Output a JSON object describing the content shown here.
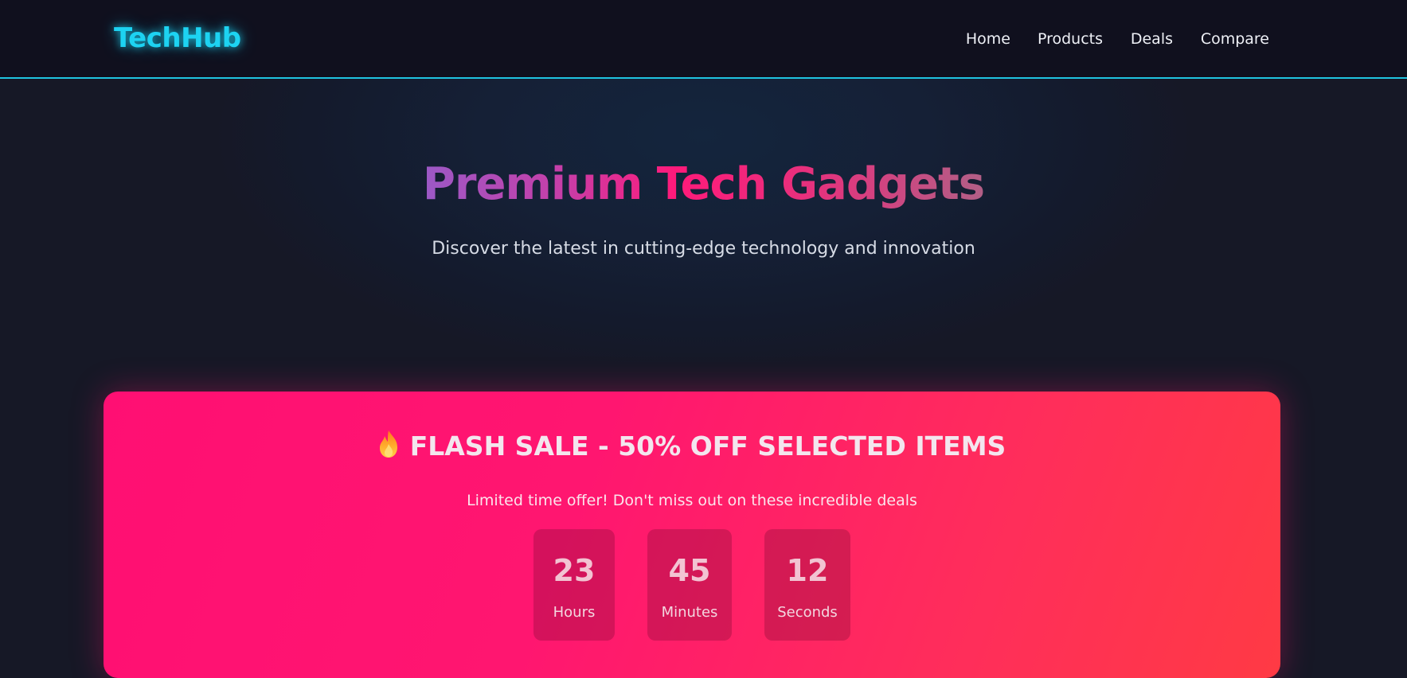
{
  "header": {
    "logo": "TechHub",
    "nav": [
      {
        "label": "Home"
      },
      {
        "label": "Products"
      },
      {
        "label": "Deals"
      },
      {
        "label": "Compare"
      }
    ]
  },
  "hero": {
    "title": "Premium Tech Gadgets",
    "subtitle": "Discover the latest in cutting-edge technology and innovation"
  },
  "flash_sale": {
    "icon": "fire-icon",
    "title": "FLASH SALE - 50% OFF SELECTED ITEMS",
    "subtitle": "Limited time offer! Don't miss out on these incredible deals",
    "countdown": [
      {
        "value": "23",
        "unit": "Hours"
      },
      {
        "value": "45",
        "unit": "Minutes"
      },
      {
        "value": "12",
        "unit": "Seconds"
      }
    ]
  },
  "colors": {
    "accent": "#1dd3f2",
    "sale_gradient_start": "#ff0f73",
    "sale_gradient_end": "#ff3a44",
    "background": "#161826"
  }
}
